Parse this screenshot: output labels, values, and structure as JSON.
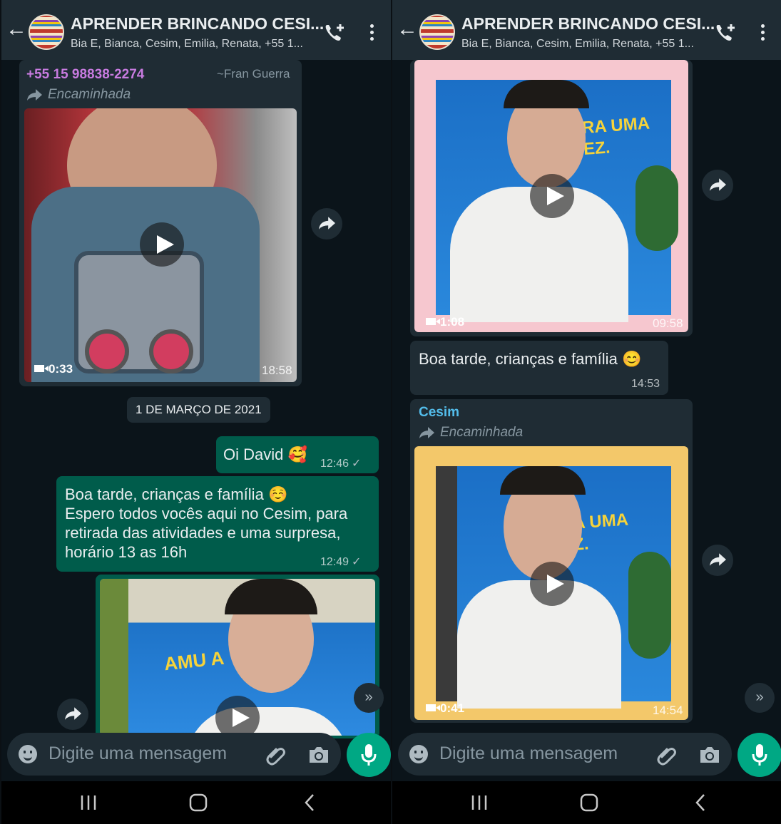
{
  "header": {
    "back_label": "←",
    "title": "APRENDER BRINCANDO CESI...",
    "subtitle": "Bia E, Bianca, Cesim, Emilia, Renata, +55 1..."
  },
  "left": {
    "first_message": {
      "sender": "+55 15 98838-2274",
      "sender_name": "~Fran Guerra",
      "forwarded_label": "Encaminhada",
      "video_duration": "0:33",
      "time": "18:58"
    },
    "date_chip": "1 DE MARÇO DE 2021",
    "out_message_1": {
      "text": "Oi David",
      "emoji": "🥰",
      "time": "12:46"
    },
    "out_message_2": {
      "line1": "Boa tarde, crianças e família",
      "emoji": "☺️",
      "line2": "Espero todos vocês aqui no Cesim, para",
      "line3": "retirada das atividades e uma surpresa,",
      "line4": "horário 13 as 16h",
      "time": "12:49"
    },
    "banner_text": "AMU A"
  },
  "right": {
    "video1": {
      "duration": "1:08",
      "time": "09:58",
      "banner_text": "ERA UMA VEZ."
    },
    "text_message": {
      "text": "Boa tarde, crianças e família",
      "emoji": "😊",
      "time": "14:53"
    },
    "forwarded_message": {
      "sender": "Cesim",
      "forwarded_label": "Encaminhada",
      "video_duration": "0:41",
      "time": "14:54",
      "banner_text": "ERA UMA VEZ."
    }
  },
  "composer": {
    "placeholder": "Digite uma mensagem"
  },
  "colors": {
    "header_bg": "#1f2c34",
    "chat_bg": "#0b141a",
    "outgoing_bubble": "#005c4b",
    "incoming_bubble": "#1f2c34",
    "accent_green": "#00a884",
    "sender_phone_color": "#c87be0",
    "sender_cesim_color": "#53bdeb"
  },
  "icons": [
    "back-arrow-icon",
    "call-add-icon",
    "more-vert-icon",
    "forward-icon",
    "play-icon",
    "video-camera-icon",
    "check-icon",
    "emoji-icon",
    "attach-icon",
    "camera-icon",
    "mic-icon",
    "scroll-down-icon",
    "nav-recents-icon",
    "nav-home-icon",
    "nav-back-icon"
  ]
}
